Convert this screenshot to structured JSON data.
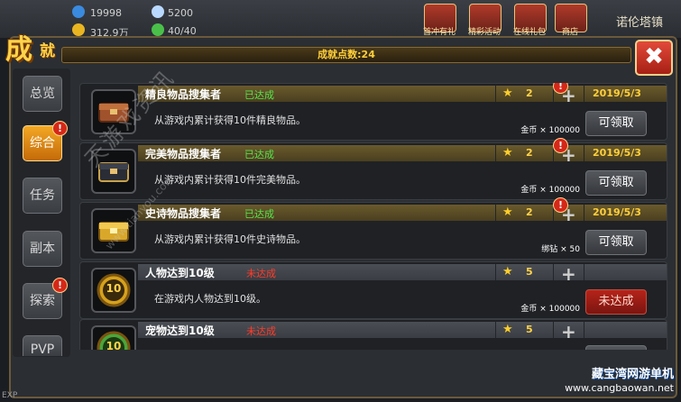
{
  "hud": {
    "resource1": "19998",
    "resource2": "5200",
    "resource3": "312.9万",
    "resource4": "40/40",
    "player_name": "诺伦塔镇",
    "buttons": [
      "首冲有礼",
      "精彩活动",
      "在线礼包",
      "商店"
    ],
    "exp_label": "EXP"
  },
  "title": {
    "part1": "成",
    "part2": "就"
  },
  "points_label": "成就点数:24",
  "close_label": "✖",
  "tabs": [
    {
      "label": "总览",
      "active": false,
      "badge": false
    },
    {
      "label": "综合",
      "active": true,
      "badge": true
    },
    {
      "label": "任务",
      "active": false,
      "badge": false
    },
    {
      "label": "副本",
      "active": false,
      "badge": false
    },
    {
      "label": "探索",
      "active": false,
      "badge": true
    },
    {
      "label": "PVP",
      "active": false,
      "badge": false
    }
  ],
  "badge_mark": "!",
  "achievements": [
    {
      "name": "精良物品搜集者",
      "status": "已达成",
      "done": true,
      "desc": "从游戏内累计获得10件精良物品。",
      "stars": "2",
      "date": "2019/5/3",
      "reward": "金币 × 100000",
      "button": "可领取",
      "badge": true,
      "icon": "chest-bronze-icon"
    },
    {
      "name": "完美物品搜集者",
      "status": "已达成",
      "done": true,
      "desc": "从游戏内累计获得10件完美物品。",
      "stars": "2",
      "date": "2019/5/3",
      "reward": "金币 × 100000",
      "button": "可领取",
      "badge": true,
      "icon": "chest-dark-icon"
    },
    {
      "name": "史诗物品搜集者",
      "status": "已达成",
      "done": true,
      "desc": "从游戏内累计获得10件史诗物品。",
      "stars": "2",
      "date": "2019/5/3",
      "reward": "绑钻 × 50",
      "button": "可领取",
      "badge": true,
      "icon": "chest-gold-icon"
    },
    {
      "name": "人物达到10级",
      "status": "未达成",
      "done": false,
      "desc": "在游戏内人物达到10级。",
      "stars": "5",
      "date": "",
      "reward": "金币 × 100000",
      "button": "未达成",
      "badge": false,
      "icon": "level-10-icon"
    },
    {
      "name": "宠物达到10级",
      "status": "未达成",
      "done": false,
      "desc": "",
      "stars": "5",
      "date": "",
      "reward": "",
      "button": "",
      "badge": false,
      "icon": "level-10-icon"
    }
  ],
  "level_badge_text": "10",
  "star_glyph": "★",
  "plus_glyph": "+",
  "watermark": {
    "cn": "天游戏资讯",
    "url": "www.tianyou.com"
  },
  "logo": {
    "text": "藏宝湾网游单机",
    "url": "www.cangbaowan.net"
  },
  "colors": {
    "accent": "#ffd34a",
    "done": "#57e44a",
    "not_done": "#ff3b2a",
    "close": "#e24a3a"
  }
}
